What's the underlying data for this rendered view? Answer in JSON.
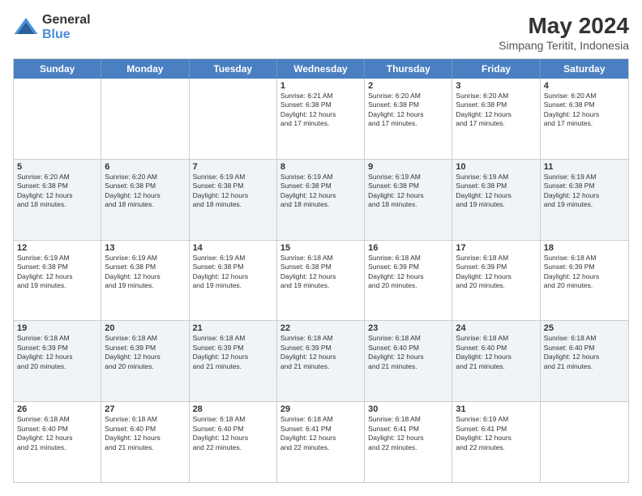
{
  "header": {
    "logo_line1": "General",
    "logo_line2": "Blue",
    "month_year": "May 2024",
    "location": "Simpang Teritit, Indonesia"
  },
  "days_of_week": [
    "Sunday",
    "Monday",
    "Tuesday",
    "Wednesday",
    "Thursday",
    "Friday",
    "Saturday"
  ],
  "weeks": [
    [
      {
        "day": "",
        "info": ""
      },
      {
        "day": "",
        "info": ""
      },
      {
        "day": "",
        "info": ""
      },
      {
        "day": "1",
        "info": "Sunrise: 6:21 AM\nSunset: 6:38 PM\nDaylight: 12 hours\nand 17 minutes."
      },
      {
        "day": "2",
        "info": "Sunrise: 6:20 AM\nSunset: 6:38 PM\nDaylight: 12 hours\nand 17 minutes."
      },
      {
        "day": "3",
        "info": "Sunrise: 6:20 AM\nSunset: 6:38 PM\nDaylight: 12 hours\nand 17 minutes."
      },
      {
        "day": "4",
        "info": "Sunrise: 6:20 AM\nSunset: 6:38 PM\nDaylight: 12 hours\nand 17 minutes."
      }
    ],
    [
      {
        "day": "5",
        "info": "Sunrise: 6:20 AM\nSunset: 6:38 PM\nDaylight: 12 hours\nand 18 minutes."
      },
      {
        "day": "6",
        "info": "Sunrise: 6:20 AM\nSunset: 6:38 PM\nDaylight: 12 hours\nand 18 minutes."
      },
      {
        "day": "7",
        "info": "Sunrise: 6:19 AM\nSunset: 6:38 PM\nDaylight: 12 hours\nand 18 minutes."
      },
      {
        "day": "8",
        "info": "Sunrise: 6:19 AM\nSunset: 6:38 PM\nDaylight: 12 hours\nand 18 minutes."
      },
      {
        "day": "9",
        "info": "Sunrise: 6:19 AM\nSunset: 6:38 PM\nDaylight: 12 hours\nand 18 minutes."
      },
      {
        "day": "10",
        "info": "Sunrise: 6:19 AM\nSunset: 6:38 PM\nDaylight: 12 hours\nand 19 minutes."
      },
      {
        "day": "11",
        "info": "Sunrise: 6:19 AM\nSunset: 6:38 PM\nDaylight: 12 hours\nand 19 minutes."
      }
    ],
    [
      {
        "day": "12",
        "info": "Sunrise: 6:19 AM\nSunset: 6:38 PM\nDaylight: 12 hours\nand 19 minutes."
      },
      {
        "day": "13",
        "info": "Sunrise: 6:19 AM\nSunset: 6:38 PM\nDaylight: 12 hours\nand 19 minutes."
      },
      {
        "day": "14",
        "info": "Sunrise: 6:19 AM\nSunset: 6:38 PM\nDaylight: 12 hours\nand 19 minutes."
      },
      {
        "day": "15",
        "info": "Sunrise: 6:18 AM\nSunset: 6:38 PM\nDaylight: 12 hours\nand 19 minutes."
      },
      {
        "day": "16",
        "info": "Sunrise: 6:18 AM\nSunset: 6:39 PM\nDaylight: 12 hours\nand 20 minutes."
      },
      {
        "day": "17",
        "info": "Sunrise: 6:18 AM\nSunset: 6:39 PM\nDaylight: 12 hours\nand 20 minutes."
      },
      {
        "day": "18",
        "info": "Sunrise: 6:18 AM\nSunset: 6:39 PM\nDaylight: 12 hours\nand 20 minutes."
      }
    ],
    [
      {
        "day": "19",
        "info": "Sunrise: 6:18 AM\nSunset: 6:39 PM\nDaylight: 12 hours\nand 20 minutes."
      },
      {
        "day": "20",
        "info": "Sunrise: 6:18 AM\nSunset: 6:39 PM\nDaylight: 12 hours\nand 20 minutes."
      },
      {
        "day": "21",
        "info": "Sunrise: 6:18 AM\nSunset: 6:39 PM\nDaylight: 12 hours\nand 21 minutes."
      },
      {
        "day": "22",
        "info": "Sunrise: 6:18 AM\nSunset: 6:39 PM\nDaylight: 12 hours\nand 21 minutes."
      },
      {
        "day": "23",
        "info": "Sunrise: 6:18 AM\nSunset: 6:40 PM\nDaylight: 12 hours\nand 21 minutes."
      },
      {
        "day": "24",
        "info": "Sunrise: 6:18 AM\nSunset: 6:40 PM\nDaylight: 12 hours\nand 21 minutes."
      },
      {
        "day": "25",
        "info": "Sunrise: 6:18 AM\nSunset: 6:40 PM\nDaylight: 12 hours\nand 21 minutes."
      }
    ],
    [
      {
        "day": "26",
        "info": "Sunrise: 6:18 AM\nSunset: 6:40 PM\nDaylight: 12 hours\nand 21 minutes."
      },
      {
        "day": "27",
        "info": "Sunrise: 6:18 AM\nSunset: 6:40 PM\nDaylight: 12 hours\nand 21 minutes."
      },
      {
        "day": "28",
        "info": "Sunrise: 6:18 AM\nSunset: 6:40 PM\nDaylight: 12 hours\nand 22 minutes."
      },
      {
        "day": "29",
        "info": "Sunrise: 6:18 AM\nSunset: 6:41 PM\nDaylight: 12 hours\nand 22 minutes."
      },
      {
        "day": "30",
        "info": "Sunrise: 6:18 AM\nSunset: 6:41 PM\nDaylight: 12 hours\nand 22 minutes."
      },
      {
        "day": "31",
        "info": "Sunrise: 6:19 AM\nSunset: 6:41 PM\nDaylight: 12 hours\nand 22 minutes."
      },
      {
        "day": "",
        "info": ""
      }
    ]
  ],
  "alt_rows": [
    false,
    true,
    false,
    true,
    false
  ]
}
